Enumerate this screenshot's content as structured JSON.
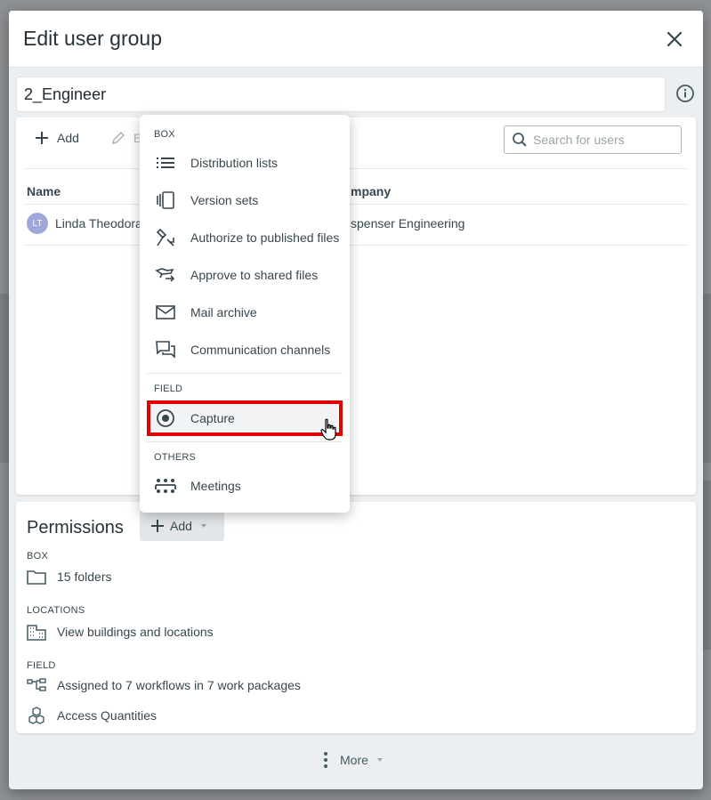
{
  "modal": {
    "title": "Edit user group",
    "group_name": "2_Engineer"
  },
  "users": {
    "toolbar": {
      "add_label": "Add",
      "edit_label": "E",
      "search_placeholder": "Search for users"
    },
    "columns": [
      "Name",
      "mpany"
    ],
    "rows": [
      {
        "initials": "LT",
        "name": "Linda Theodora",
        "company": "spenser Engineering"
      }
    ]
  },
  "dropdown": {
    "sections": [
      {
        "label": "BOX",
        "items": [
          {
            "label": "Distribution lists",
            "icon": "list-icon"
          },
          {
            "label": "Version sets",
            "icon": "version-sets-icon"
          },
          {
            "label": "Authorize to published files",
            "icon": "authorize-icon"
          },
          {
            "label": "Approve to shared files",
            "icon": "approve-icon"
          },
          {
            "label": "Mail archive",
            "icon": "mail-icon"
          },
          {
            "label": "Communication channels",
            "icon": "chat-icon"
          }
        ]
      },
      {
        "label": "FIELD",
        "items": [
          {
            "label": "Capture",
            "icon": "capture-icon",
            "highlighted": true
          }
        ]
      },
      {
        "label": "OTHERS",
        "items": [
          {
            "label": "Meetings",
            "icon": "meetings-icon"
          }
        ]
      }
    ]
  },
  "permissions": {
    "title": "Permissions",
    "add_label": "Add",
    "sections": [
      {
        "label": "BOX",
        "items": [
          {
            "label": "15 folders",
            "icon": "folder-icon"
          }
        ]
      },
      {
        "label": "LOCATIONS",
        "items": [
          {
            "label": "View buildings and locations",
            "icon": "building-icon"
          }
        ]
      },
      {
        "label": "FIELD",
        "items": [
          {
            "label": "Assigned to 7 workflows in 7 work packages",
            "icon": "workflow-icon"
          },
          {
            "label": "Access Quantities",
            "icon": "cubes-icon"
          }
        ]
      }
    ]
  },
  "footer": {
    "more_label": "More"
  },
  "colors": {
    "highlight_border": "#e00000",
    "avatar": "#9fa8da"
  }
}
